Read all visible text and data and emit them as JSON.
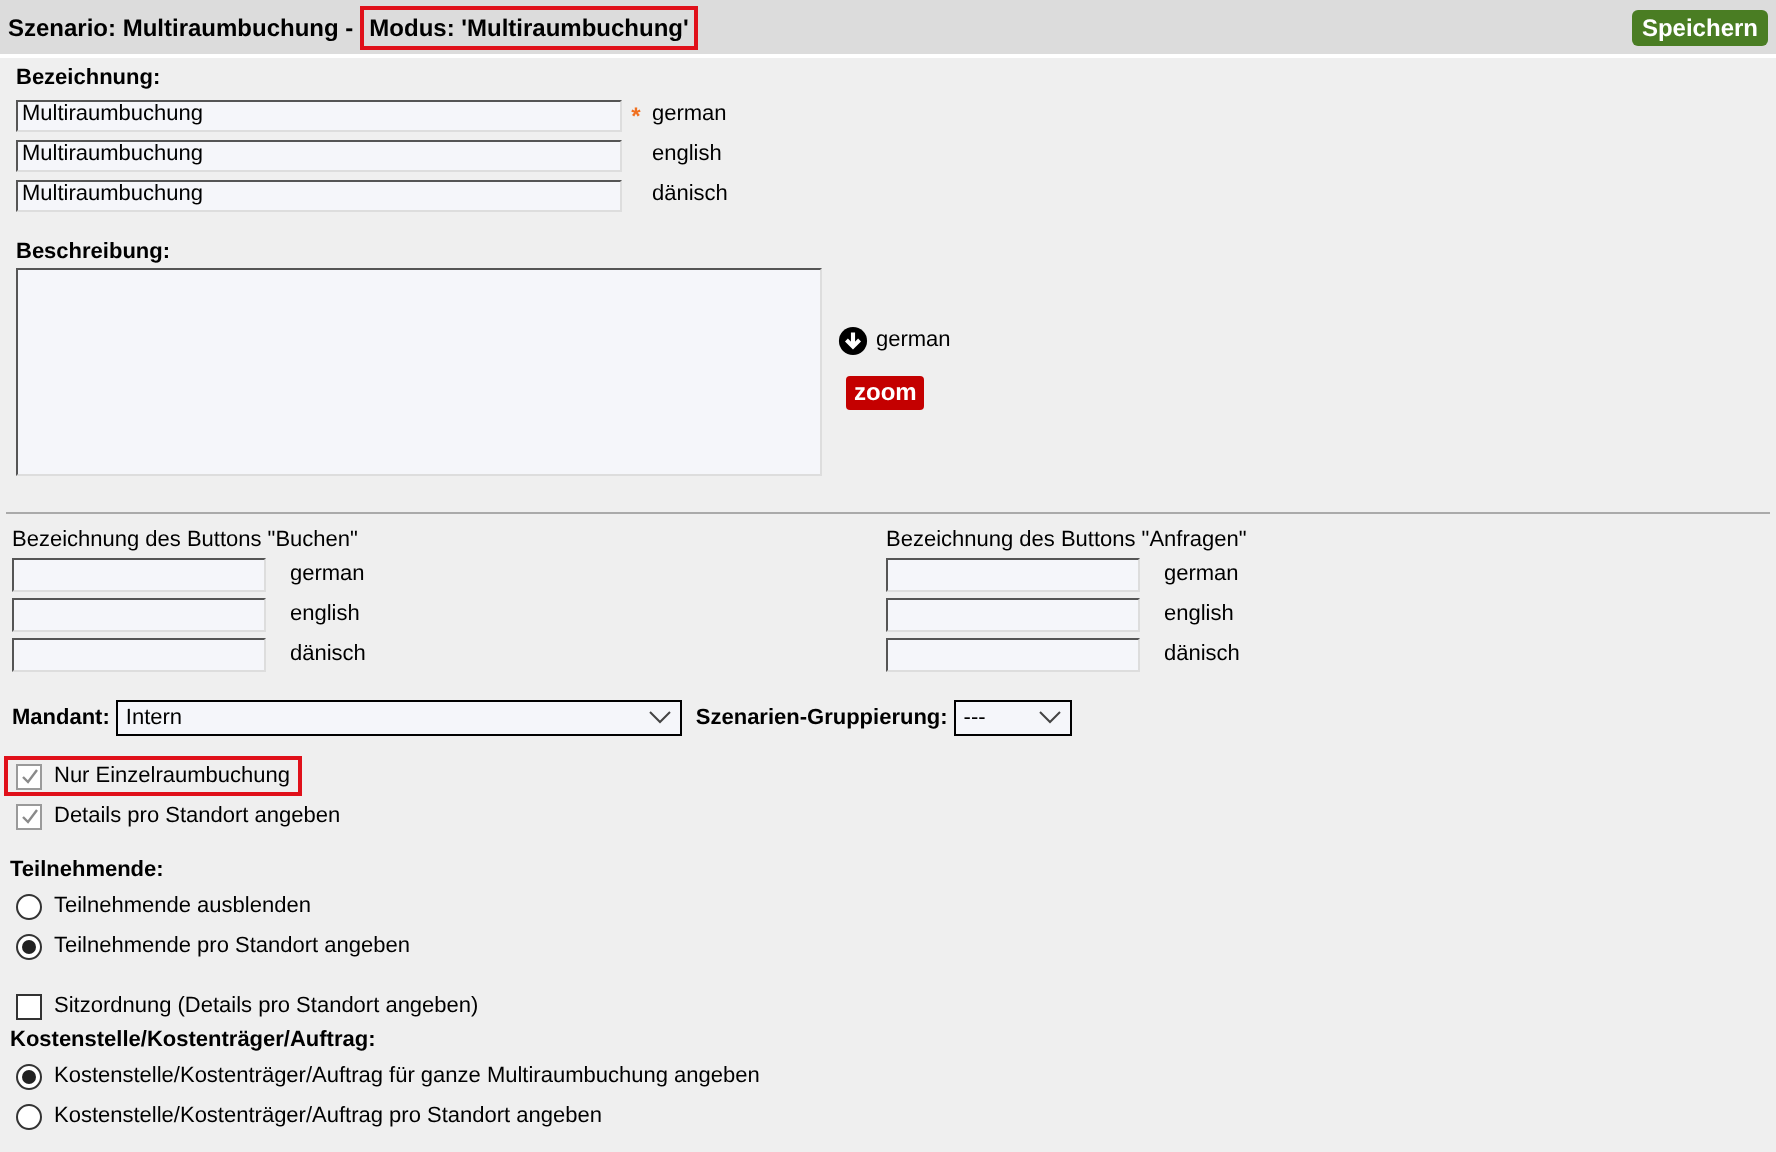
{
  "header": {
    "scenario": "Szenario: Multiraumbuchung -",
    "mode": "Modus: 'Multiraumbuchung'",
    "mode_highlighted": true,
    "save_button": "Speichern"
  },
  "bezeichnung": {
    "label": "Bezeichnung:",
    "required_mark": "*",
    "fields": [
      {
        "value": "Multiraumbuchung",
        "language": "german",
        "required": true
      },
      {
        "value": "Multiraumbuchung",
        "language": "english",
        "required": false
      },
      {
        "value": "Multiraumbuchung",
        "language": "dänisch",
        "required": false
      }
    ]
  },
  "beschreibung": {
    "label": "Beschreibung:",
    "language": "german",
    "zoom_button": "zoom"
  },
  "button_labels": [
    {
      "label": "Bezeichnung des Buttons \"Buchen\"",
      "languages": [
        "german",
        "english",
        "dänisch"
      ]
    },
    {
      "label": "Bezeichnung des Buttons \"Anfragen\"",
      "languages": [
        "german",
        "english",
        "dänisch"
      ]
    }
  ],
  "mandant": {
    "label": "Mandant:",
    "value": "Intern"
  },
  "gruppierung": {
    "label": "Szenarien-Gruppierung:",
    "value": "---"
  },
  "options": [
    {
      "kind": "checkbox",
      "label": "Nur Einzelraumbuchung",
      "checked": true,
      "disabled": true,
      "highlighted": true
    },
    {
      "kind": "checkbox",
      "label": "Details pro Standort angeben",
      "checked": true,
      "disabled": true,
      "highlighted": false
    },
    {
      "kind": "spacer"
    },
    {
      "kind": "heading",
      "label": "Teilnehmende:"
    },
    {
      "kind": "radio",
      "label": "Teilnehmende ausblenden",
      "selected": false
    },
    {
      "kind": "radio",
      "label": "Teilnehmende pro Standort angeben",
      "selected": true
    },
    {
      "kind": "spacer"
    },
    {
      "kind": "checkbox",
      "label": "Sitzordnung (Details pro Standort angeben)",
      "checked": false,
      "disabled": false,
      "highlighted": false
    },
    {
      "kind": "heading",
      "label": "Kostenstelle/Kostenträger/Auftrag:"
    },
    {
      "kind": "radio",
      "label": "Kostenstelle/Kostenträger/Auftrag für ganze Multiraumbuchung angeben",
      "selected": true
    },
    {
      "kind": "radio",
      "label": "Kostenstelle/Kostenträger/Auftrag pro Standort angeben",
      "selected": false
    }
  ]
}
